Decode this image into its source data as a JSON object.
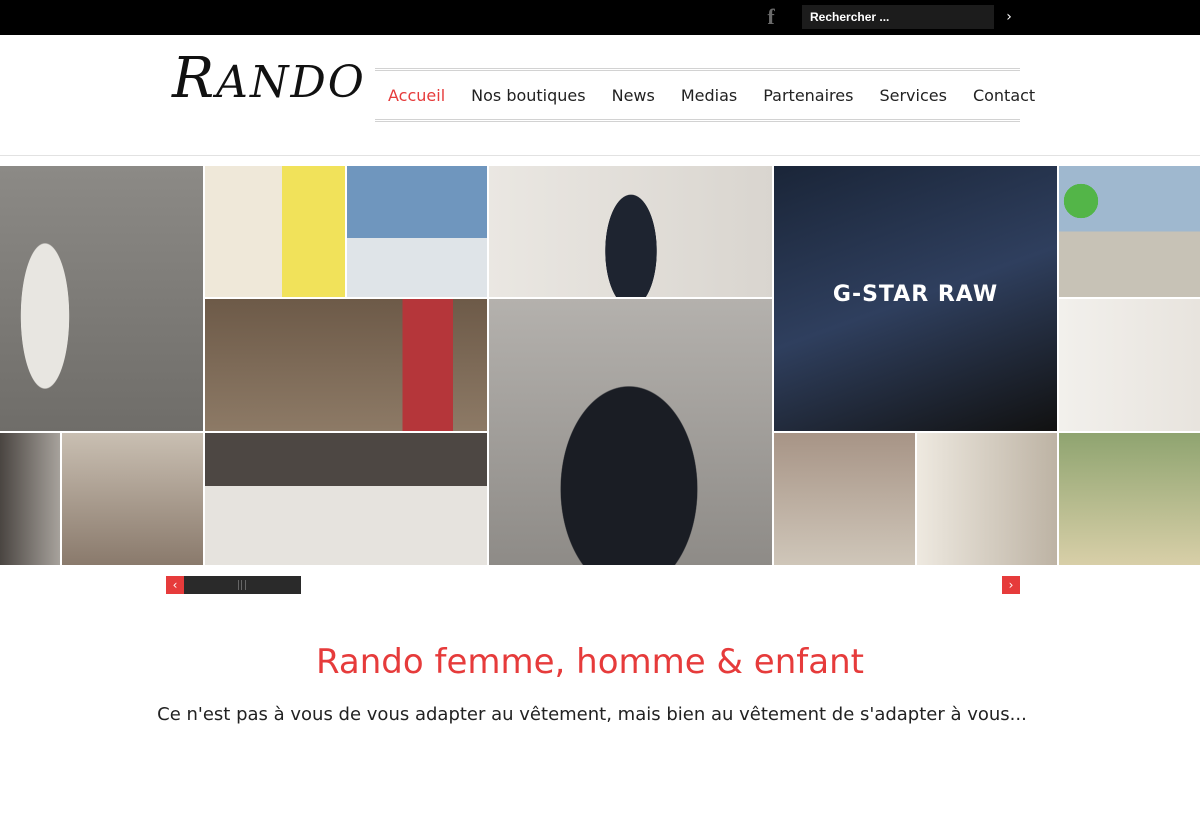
{
  "topbar": {
    "facebook_icon": "facebook-icon",
    "search": {
      "placeholder": "Rechercher ...",
      "value": "",
      "submit_icon": "chevron-right-icon"
    }
  },
  "header": {
    "logo_text": "RANDO",
    "nav": [
      {
        "label": "Accueil",
        "active": true
      },
      {
        "label": "Nos boutiques",
        "active": false
      },
      {
        "label": "News",
        "active": false
      },
      {
        "label": "Medias",
        "active": false
      },
      {
        "label": "Partenaires",
        "active": false
      },
      {
        "label": "Services",
        "active": false
      },
      {
        "label": "Contact",
        "active": false
      }
    ]
  },
  "mosaic": {
    "gstar_text": "G-STAR RAW"
  },
  "slider": {
    "prev_icon": "chevron-left-icon",
    "next_icon": "chevron-right-icon"
  },
  "content": {
    "headline": "Rando femme, homme & enfant",
    "tagline": "Ce n'est pas à vous de vous adapter au vêtement, mais bien au vêtement de s'adapter à vous..."
  },
  "colors": {
    "accent": "#e63b3b",
    "topbar": "#000000",
    "text": "#222222"
  }
}
